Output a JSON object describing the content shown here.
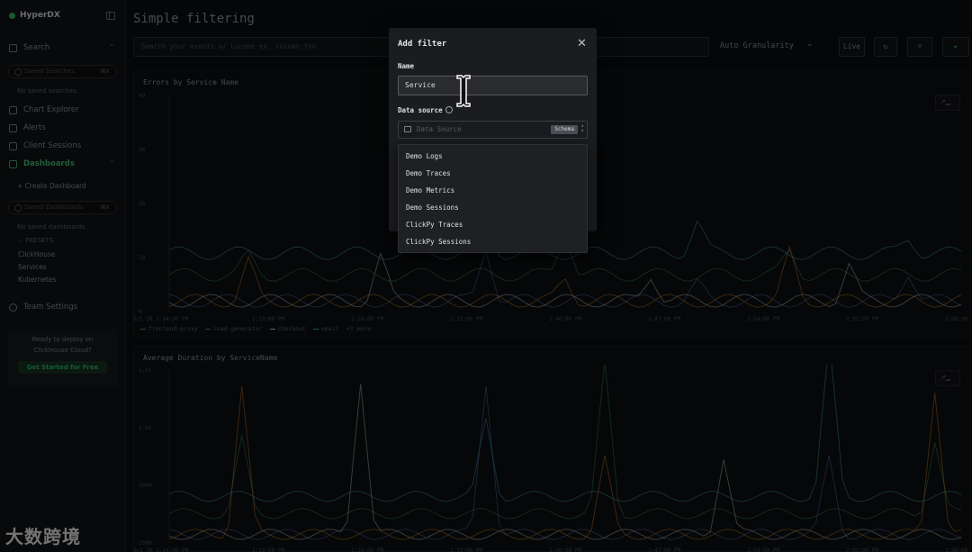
{
  "app": {
    "name": "HyperDX"
  },
  "sidebar": {
    "search": {
      "label": "Search",
      "placeholder": "Saved Searches",
      "kbd": "⌘K",
      "empty": "No saved searches"
    },
    "nav": [
      {
        "label": "Chart Explorer"
      },
      {
        "label": "Alerts"
      },
      {
        "label": "Client Sessions"
      }
    ],
    "dashboards": {
      "label": "Dashboards",
      "create": "+ Create Dashboard",
      "placeholder": "Saved Dashboards",
      "kbd": "⌘K",
      "empty": "No saved dashboards",
      "presets_label": "PRESETS",
      "presets": [
        "ClickHouse",
        "Services",
        "Kubernetes"
      ]
    },
    "team_settings": "Team Settings",
    "promo": {
      "line1": "Ready to deploy on",
      "line2": "ClickHouse Cloud?",
      "button": "Get Started for Free"
    },
    "watermark": "大数跨境"
  },
  "header": {
    "title": "Simple filtering",
    "search_placeholder": "Search your events w/ Lucene ex. column:foo",
    "granularity": "Auto Granularity",
    "live_label": "Live"
  },
  "charts": [
    {
      "title": "Errors by Service Name",
      "y_ticks": [
        "40",
        "30",
        "20",
        "10",
        "0"
      ],
      "x_ticks": [
        "Oct 20 1:14:00 PM",
        "1:19:00 PM",
        "1:26:00 PM",
        "1:33:00 PM",
        "1:40:00 PM",
        "1:47:00 PM",
        "1:54:00 PM",
        "2:01:00 PM",
        "2:08:00 PM"
      ],
      "legend": [
        "frontend-proxy",
        "load-generator",
        "checkout",
        "email",
        "+3 more"
      ]
    },
    {
      "title": "Average Duration by ServiceName",
      "y_ticks": [
        "1.5s",
        "1.0s",
        "500M",
        "250M"
      ],
      "x_ticks": [
        "Oct 20 1:14:00 PM",
        "1:19:00 PM",
        "1:26:00 PM",
        "1:33:00 PM",
        "1:40:00 PM",
        "1:47:00 PM",
        "1:54:00 PM",
        "2:01:00 PM",
        "2:08:00 PM"
      ]
    }
  ],
  "modal": {
    "title": "Add filter",
    "name_label": "Name",
    "name_value": "Service",
    "ds_label": "Data source",
    "ds_placeholder": "Data Source",
    "schema_badge": "Schema",
    "options": [
      "Demo Logs",
      "Demo Traces",
      "Demo Metrics",
      "Demo Sessions",
      "ClickPy Traces",
      "ClickPy Sessions"
    ]
  },
  "colors": {
    "accent": "#2fb36b",
    "series": [
      "#3a8f5a",
      "#5b6fb3",
      "#c9c9c9",
      "#d0822a",
      "#3fa0b8"
    ]
  }
}
